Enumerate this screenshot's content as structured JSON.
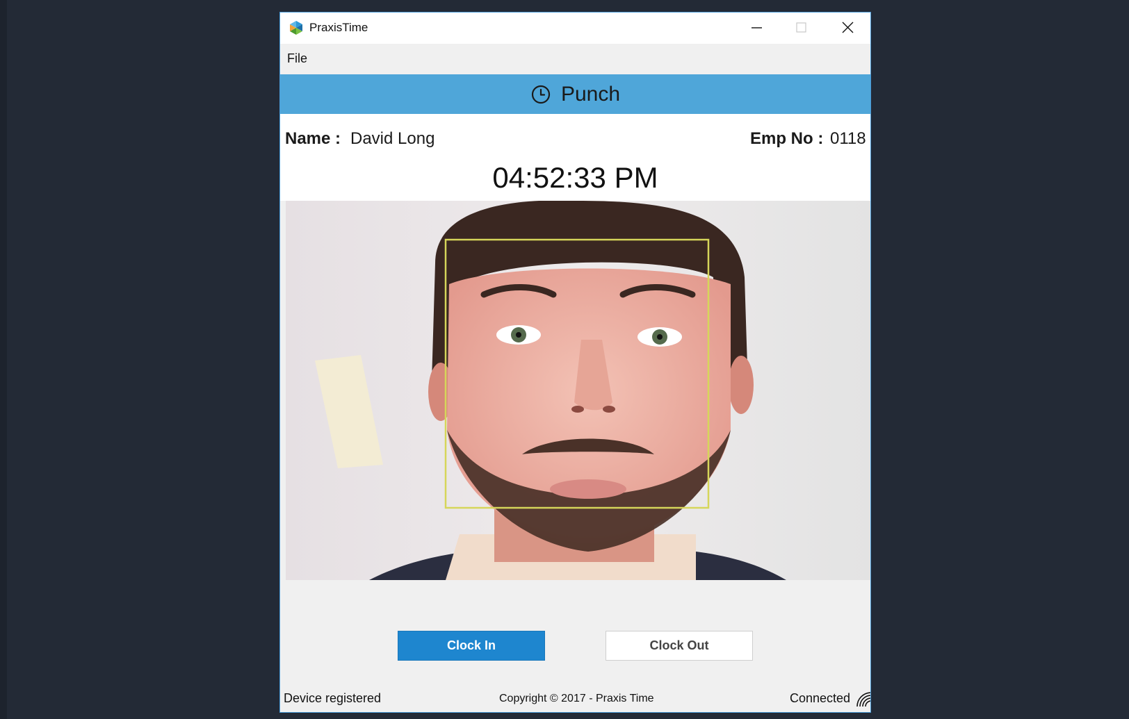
{
  "window": {
    "title": "PraxisTime",
    "minimize_icon": "minimize-icon",
    "maximize_icon": "maximize-icon",
    "close_icon": "close-icon"
  },
  "menu": {
    "file_label": "File"
  },
  "header": {
    "icon": "clock-icon",
    "title": "Punch"
  },
  "employee": {
    "name_label": "Name :",
    "name_value": "David Long",
    "emp_no_label": "Emp No :",
    "emp_no_value": "0118"
  },
  "clock": {
    "time": "04:52:33 PM"
  },
  "camera": {
    "face_detected": true,
    "face_box_color": "#d6d65a"
  },
  "actions": {
    "clock_in_label": "Clock In",
    "clock_out_label": "Clock Out"
  },
  "status": {
    "left": "Device registered",
    "center": "Copyright © 2017 - Praxis Time",
    "right": "Connected",
    "right_icon": "wifi-icon"
  },
  "colors": {
    "accent": "#4fa6d9",
    "primary_button": "#1e86cf",
    "desktop": "#232a36"
  }
}
